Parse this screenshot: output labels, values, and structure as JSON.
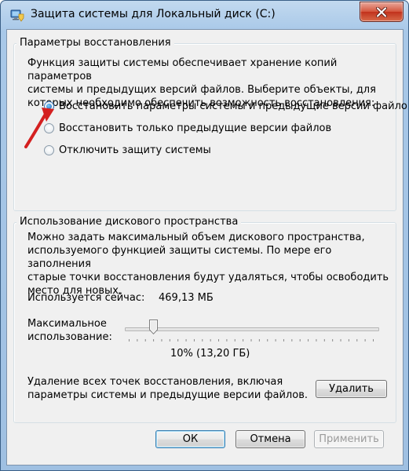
{
  "window": {
    "title": "Защита системы для Локальный диск (C:)"
  },
  "restore": {
    "group_label": "Параметры восстановления",
    "description_lines": [
      "Функция защиты системы обеспечивает хранение копий параметров",
      "системы и предыдущих версий файлов. Выберите объекты, для",
      "которых необходимо обеспечить возможность восстановления:"
    ],
    "options": [
      {
        "label": "Восстановить параметры системы и предыдущие версии файлов",
        "checked": true
      },
      {
        "label": "Восстановить только предыдущие версии файлов",
        "checked": false
      },
      {
        "label": "Отключить защиту системы",
        "checked": false
      }
    ]
  },
  "disk": {
    "group_label": "Использование дискового пространства",
    "description_lines": [
      "Можно задать максимальный объем дискового пространства,",
      "используемого функцией защиты системы. По мере его заполнения",
      "старые точки восстановления будут удаляться, чтобы освободить",
      "место для новых."
    ],
    "current_usage_label": "Используется сейчас:",
    "current_usage_value": "469,13 МБ",
    "max_usage_label_line1": "Максимальное",
    "max_usage_label_line2": "использование:",
    "slider_fraction": 0.1,
    "max_usage_value": "10% (13,20 ГБ)",
    "delete_text_line1": "Удаление всех точек восстановления, включая",
    "delete_text_line2": "параметры системы и предыдущие версии файлов.",
    "delete_button": "Удалить"
  },
  "footer": {
    "ok": "ОК",
    "cancel": "Отмена",
    "apply": "Применить"
  },
  "colors": {
    "annotation_arrow": "#d42020"
  }
}
